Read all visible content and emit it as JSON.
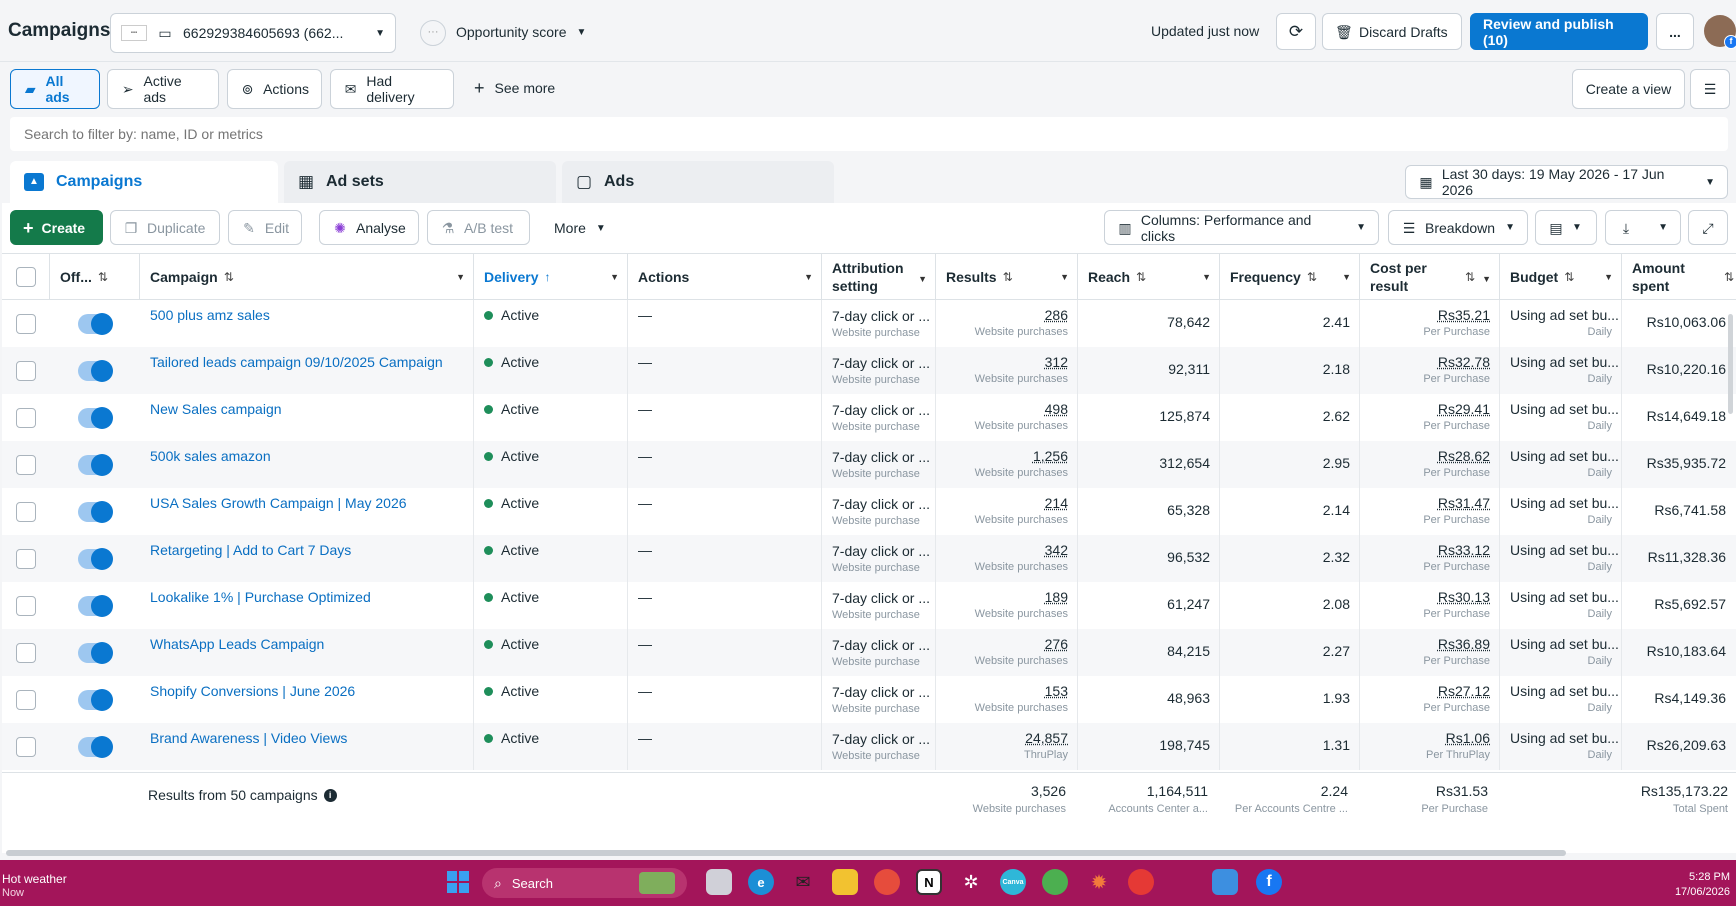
{
  "header": {
    "title": "Campaigns",
    "account_id": "662929384605693 (662...",
    "opportunity_score_label": "Opportunity score",
    "updated_text": "Updated just now",
    "discard_label": "Discard Drafts",
    "review_label": "Review and publish (10)",
    "more_label": "..."
  },
  "filters": {
    "all_ads": "All ads",
    "active_ads": "Active ads",
    "actions": "Actions",
    "had_delivery": "Had delivery",
    "see_more": "See more",
    "create_view": "Create a view"
  },
  "search": {
    "placeholder": "Search to filter by: name, ID or metrics"
  },
  "level_tabs": {
    "campaigns": "Campaigns",
    "ad_sets": "Ad sets",
    "ads": "Ads",
    "date_range": "Last 30 days: 19 May 2026 - 17 Jun 2026"
  },
  "toolbar": {
    "create": "Create",
    "duplicate": "Duplicate",
    "edit": "Edit",
    "analyse": "Analyse",
    "ab_test": "A/B test",
    "more": "More",
    "columns": "Columns: Performance and clicks",
    "breakdown": "Breakdown"
  },
  "columns": {
    "off": "Off...",
    "campaign": "Campaign",
    "delivery": "Delivery",
    "actions": "Actions",
    "attribution_1": "Attribution",
    "attribution_2": "setting",
    "results": "Results",
    "reach": "Reach",
    "frequency": "Frequency",
    "cost_1": "Cost per",
    "cost_2": "result",
    "budget": "Budget",
    "amount_1": "Amount",
    "amount_2": "spent"
  },
  "rows": [
    {
      "name": "500 plus amz sales",
      "delivery": "Active",
      "actions": "—",
      "attribution": "7-day click or ...",
      "attribution_sub": "Website purchase",
      "results": "286",
      "results_sub": "Website purchases",
      "reach": "78,642",
      "frequency": "2.41",
      "cost": "Rs35.21",
      "cost_sub": "Per Purchase",
      "budget": "Using ad set bu...",
      "budget_sub": "Daily",
      "amount": "Rs10,063.06"
    },
    {
      "name": "Tailored leads campaign 09/10/2025 Campaign",
      "delivery": "Active",
      "actions": "—",
      "attribution": "7-day click or ...",
      "attribution_sub": "Website purchase",
      "results": "312",
      "results_sub": "Website purchases",
      "reach": "92,311",
      "frequency": "2.18",
      "cost": "Rs32.78",
      "cost_sub": "Per Purchase",
      "budget": "Using ad set bu...",
      "budget_sub": "Daily",
      "amount": "Rs10,220.16"
    },
    {
      "name": "New Sales campaign",
      "delivery": "Active",
      "actions": "—",
      "attribution": "7-day click or ...",
      "attribution_sub": "Website purchase",
      "results": "498",
      "results_sub": "Website purchases",
      "reach": "125,874",
      "frequency": "2.62",
      "cost": "Rs29.41",
      "cost_sub": "Per Purchase",
      "budget": "Using ad set bu...",
      "budget_sub": "Daily",
      "amount": "Rs14,649.18"
    },
    {
      "name": "500k sales amazon",
      "delivery": "Active",
      "actions": "—",
      "attribution": "7-day click or ...",
      "attribution_sub": "Website purchase",
      "results": "1,256",
      "results_sub": "Website purchases",
      "reach": "312,654",
      "frequency": "2.95",
      "cost": "Rs28.62",
      "cost_sub": "Per Purchase",
      "budget": "Using ad set bu...",
      "budget_sub": "Daily",
      "amount": "Rs35,935.72"
    },
    {
      "name": "USA Sales Growth Campaign | May 2026",
      "delivery": "Active",
      "actions": "—",
      "attribution": "7-day click or ...",
      "attribution_sub": "Website purchase",
      "results": "214",
      "results_sub": "Website purchases",
      "reach": "65,328",
      "frequency": "2.14",
      "cost": "Rs31.47",
      "cost_sub": "Per Purchase",
      "budget": "Using ad set bu...",
      "budget_sub": "Daily",
      "amount": "Rs6,741.58"
    },
    {
      "name": "Retargeting | Add to Cart 7 Days",
      "delivery": "Active",
      "actions": "—",
      "attribution": "7-day click or ...",
      "attribution_sub": "Website purchase",
      "results": "342",
      "results_sub": "Website purchases",
      "reach": "96,532",
      "frequency": "2.32",
      "cost": "Rs33.12",
      "cost_sub": "Per Purchase",
      "budget": "Using ad set bu...",
      "budget_sub": "Daily",
      "amount": "Rs11,328.36"
    },
    {
      "name": "Lookalike 1% | Purchase Optimized",
      "delivery": "Active",
      "actions": "—",
      "attribution": "7-day click or ...",
      "attribution_sub": "Website purchase",
      "results": "189",
      "results_sub": "Website purchases",
      "reach": "61,247",
      "frequency": "2.08",
      "cost": "Rs30.13",
      "cost_sub": "Per Purchase",
      "budget": "Using ad set bu...",
      "budget_sub": "Daily",
      "amount": "Rs5,692.57"
    },
    {
      "name": "WhatsApp Leads Campaign",
      "delivery": "Active",
      "actions": "—",
      "attribution": "7-day click or ...",
      "attribution_sub": "Website purchase",
      "results": "276",
      "results_sub": "Website purchases",
      "reach": "84,215",
      "frequency": "2.27",
      "cost": "Rs36.89",
      "cost_sub": "Per Purchase",
      "budget": "Using ad set bu...",
      "budget_sub": "Daily",
      "amount": "Rs10,183.64"
    },
    {
      "name": "Shopify Conversions | June 2026",
      "delivery": "Active",
      "actions": "—",
      "attribution": "7-day click or ...",
      "attribution_sub": "Website purchase",
      "results": "153",
      "results_sub": "Website purchases",
      "reach": "48,963",
      "frequency": "1.93",
      "cost": "Rs27.12",
      "cost_sub": "Per Purchase",
      "budget": "Using ad set bu...",
      "budget_sub": "Daily",
      "amount": "Rs4,149.36"
    },
    {
      "name": "Brand Awareness | Video Views",
      "delivery": "Active",
      "actions": "—",
      "attribution": "7-day click or ...",
      "attribution_sub": "Website purchase",
      "results": "24,857",
      "results_sub": "ThruPlay",
      "reach": "198,745",
      "frequency": "1.31",
      "cost": "Rs1.06",
      "cost_sub": "Per ThruPlay",
      "budget": "Using ad set bu...",
      "budget_sub": "Daily",
      "amount": "Rs26,209.63"
    }
  ],
  "totals": {
    "label": "Results from 50 campaigns",
    "results": "3,526",
    "results_sub": "Website purchases",
    "reach": "1,164,511",
    "reach_sub": "Accounts Center a...",
    "frequency": "2.24",
    "frequency_sub": "Per Accounts Centre ...",
    "cost": "Rs31.53",
    "cost_sub": "Per Purchase",
    "amount": "Rs135,173.22",
    "amount_sub": "Total Spent"
  },
  "taskbar": {
    "weather": "Hot weather",
    "weather_sub": "Now",
    "search": "Search",
    "time": "5:28 PM",
    "date": "17/06/2026"
  },
  "colors": {
    "accent": "#0a78d1",
    "create": "#147a4a",
    "taskbar": "#a3155a",
    "active": "#1e8e5a"
  }
}
